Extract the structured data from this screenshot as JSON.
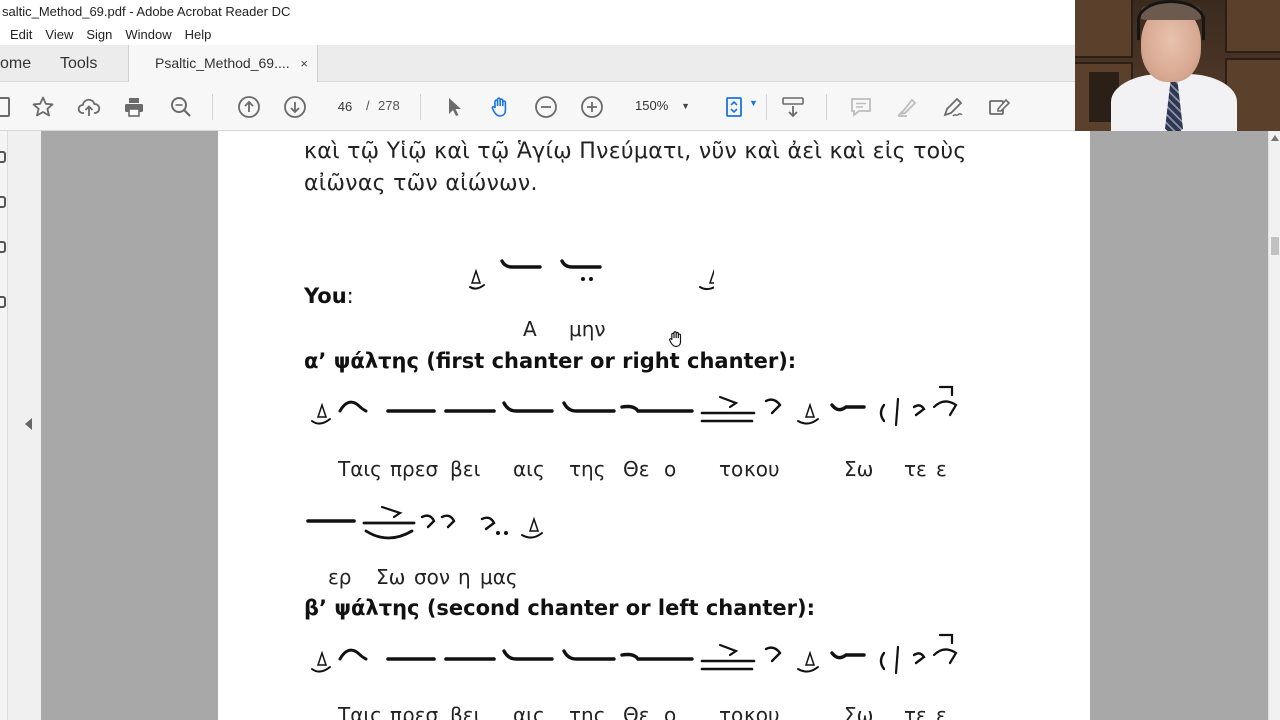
{
  "window": {
    "title": "saltic_Method_69.pdf - Adobe Acrobat Reader DC"
  },
  "menubar": {
    "items": [
      "Edit",
      "View",
      "Sign",
      "Window",
      "Help"
    ]
  },
  "tabs": {
    "home": "ome",
    "tools": "Tools",
    "document": "Psaltic_Method_69....",
    "close_glyph": "×"
  },
  "toolbar": {
    "page_current": "46",
    "page_separator": "/",
    "page_total": "278",
    "zoom": "150%",
    "icons": [
      "star-icon",
      "cloud-upload-icon",
      "print-icon",
      "zoom-search-icon",
      "prev-page-icon",
      "next-page-icon",
      "select-pointer-icon",
      "hand-tool-icon",
      "zoom-out-icon",
      "zoom-in-icon",
      "fit-page-icon",
      "scroll-mode-icon",
      "comment-icon",
      "highlight-icon",
      "sign-icon",
      "edit-pdf-icon"
    ]
  },
  "document": {
    "top_line_1": "καὶ τῷ Υἱῷ καὶ τῷ Ἁγίῳ Πνεύματι, νῦν καὶ ἀεὶ καὶ εἰς τοὺς",
    "top_line_2": "αἰῶνας τῶν αἰώνων.",
    "you_label": "You",
    "you_colon": ":",
    "you_syllables": [
      "Α",
      "μην"
    ],
    "first_chanter_heading": "α’ ψάλτης (first chanter or right chanter):",
    "first_chanter_syllables": [
      "Ταις",
      "πρεσ",
      "βει",
      "αις",
      "της",
      "Θε",
      "ο",
      "το",
      "κου",
      "Σω",
      "τε",
      "ε"
    ],
    "first_chanter_syllables_2": [
      "ερ",
      "Σω",
      "σον",
      "η",
      "μας"
    ],
    "second_chanter_heading": "β’ ψάλτης (second chanter or left chanter):",
    "second_chanter_syllables": [
      "Ταις",
      "πρεσ",
      "βει",
      "αις",
      "της",
      "Θε",
      "ο",
      "το",
      "κου",
      "Σω",
      "τε",
      "ε"
    ]
  },
  "colors": {
    "toolbar_bg": "#f7f7f7",
    "tab_bg": "#ececec",
    "viewer_bg": "#a8a8a8",
    "page_bg": "#ffffff",
    "icon_gray": "#6b6b6b",
    "accent_blue": "#1a73e8"
  }
}
